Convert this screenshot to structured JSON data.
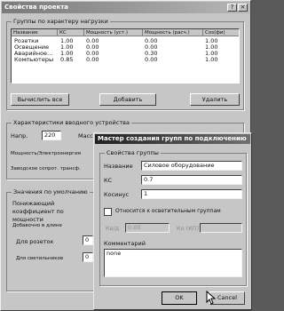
{
  "window": {
    "title": "Свойства проекта",
    "help_btn": "?",
    "close_btn": "×"
  },
  "load_group": {
    "title": "Группы по характеру нагрузки",
    "columns": [
      "Название",
      "КС",
      "Мощность (уст.)",
      "Мощность (расч.)",
      "Cos(фи)"
    ],
    "rows": [
      [
        "Розетки",
        "1.00",
        "0.00",
        "0.00",
        "1.00"
      ],
      [
        "Освещение",
        "1.00",
        "0.00",
        "0.00",
        "1.00"
      ],
      [
        "Аварийное...",
        "1.00",
        "0.00",
        "0.30",
        "1.00"
      ],
      [
        "Компьютеры",
        "0.85",
        "0.00",
        "0.00",
        "1.00"
      ]
    ],
    "buttons": {
      "calc_all": "Вычислить все",
      "add": "Добавить",
      "delete": "Удалить"
    }
  },
  "input_group": {
    "title": "Характеристики вводного устройства",
    "voltage_label": "Напр.",
    "voltage_value": "220",
    "mass_label": "Масс",
    "power_label": "Мощность/Электроэнергия",
    "cable_label": "Заводское сопрот. трансф."
  },
  "default_group": {
    "title": "Значения по умолчанию",
    "coef_label": "Понижающий коэффициент по мощности",
    "added_label": "Добавочно в длине",
    "sockets_label": "Для розеток",
    "sockets_value": "0",
    "lighting_label": "Для светильников",
    "lighting_value": "0"
  },
  "dialog": {
    "title": "Мастер создания групп по подключению",
    "group_title": "Свойства группы",
    "name_label": "Название",
    "name_value": "Силовое оборудование",
    "kc_label": "КС",
    "kc_value": "0.7",
    "cos_label": "Косинус",
    "cos_value": "1",
    "lighting_check_label": "Относится к осветительным группам",
    "k1_label": "Кв/д",
    "k1_value": "0.00",
    "k2_label": "Ко (КП)",
    "k2_value": "",
    "comment_label": "Комментарий",
    "comment_value": "none",
    "ok_label": "OK",
    "cancel_label": "Cancel"
  }
}
